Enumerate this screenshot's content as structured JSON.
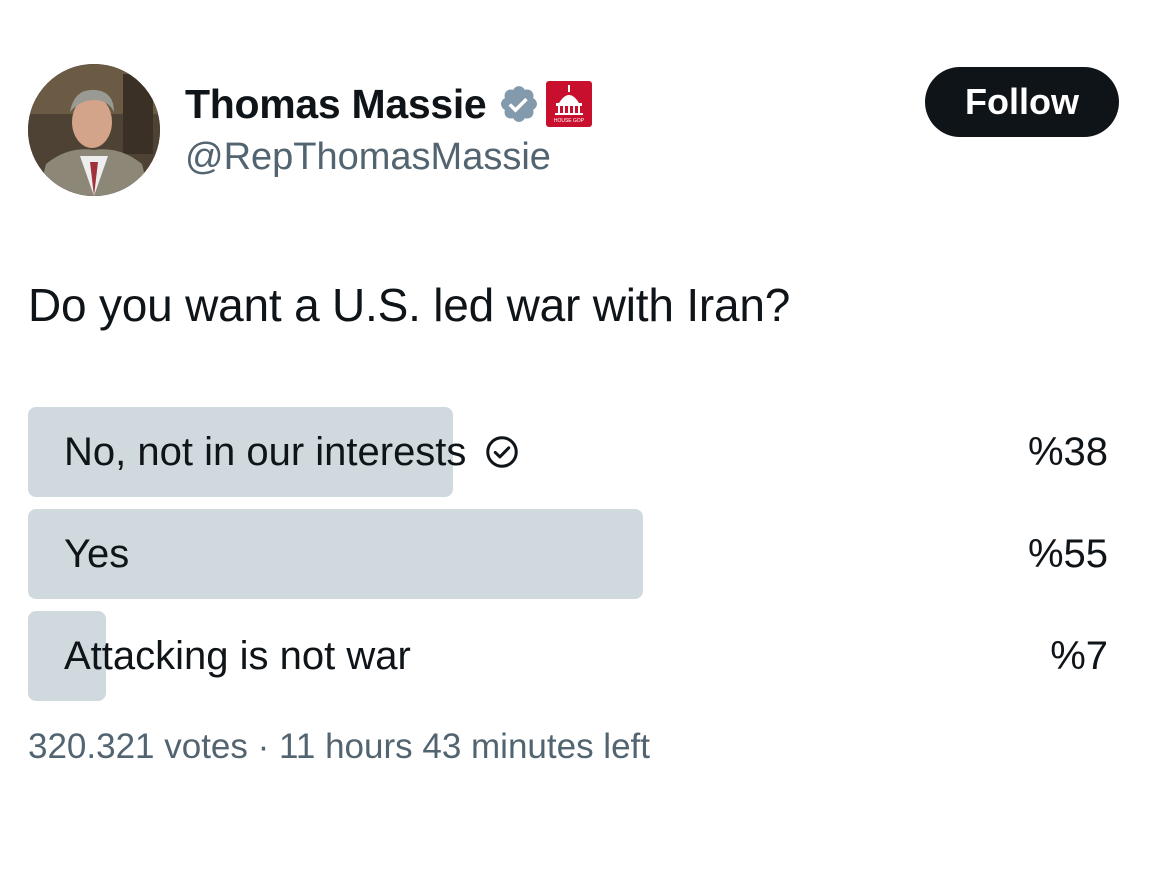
{
  "author": {
    "name": "Thomas Massie",
    "handle": "@RepThomasMassie",
    "avatar": "profile-photo",
    "badges": [
      "verified-badge-icon",
      "house-gop-badge-icon"
    ],
    "gop_badge_text": "HOUSE GOP"
  },
  "follow_label": "Follow",
  "post": {
    "question": "Do you want a U.S. led war with Iran?"
  },
  "poll": {
    "options": [
      {
        "label": "No, not in our interests",
        "percent_label": "%38",
        "fraction": 0.38,
        "selected": true
      },
      {
        "label": "Yes",
        "percent_label": "%55",
        "fraction": 0.55,
        "selected": false
      },
      {
        "label": "Attacking is not war",
        "percent_label": "%7",
        "fraction": 0.07,
        "selected": false
      }
    ],
    "votes": "320.321 votes",
    "separator": "·",
    "time_left": "11 hours 43 minutes left"
  },
  "colors": {
    "text": "#0f1419",
    "secondary_text": "#536471",
    "bar": "#cfd9de",
    "follow_bg": "#0f1419",
    "follow_text": "#ffffff",
    "verified": "#829aab",
    "gop_badge": "#c8102e"
  }
}
